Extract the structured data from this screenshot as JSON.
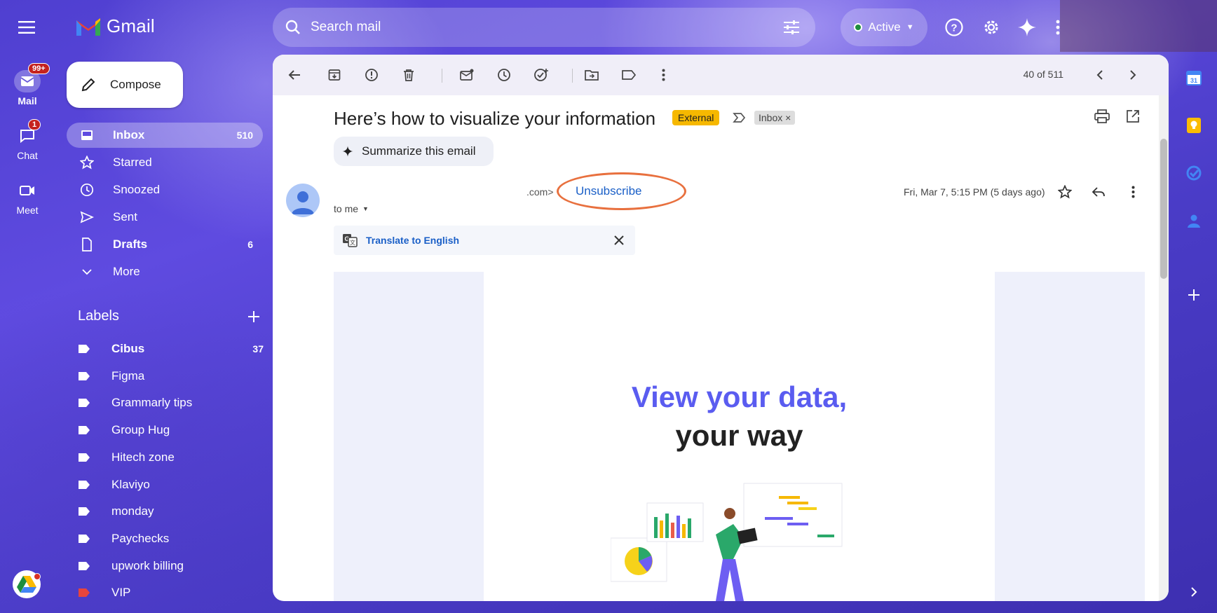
{
  "app": {
    "name": "Gmail"
  },
  "rail": {
    "items": [
      {
        "label": "Mail",
        "badge": "99+"
      },
      {
        "label": "Chat",
        "badge": "1"
      },
      {
        "label": "Meet",
        "badge": ""
      }
    ]
  },
  "search": {
    "placeholder": "Search mail"
  },
  "status": {
    "label": "Active"
  },
  "compose": {
    "label": "Compose"
  },
  "nav": {
    "items": [
      {
        "label": "Inbox",
        "count": "510"
      },
      {
        "label": "Starred",
        "count": ""
      },
      {
        "label": "Snoozed",
        "count": ""
      },
      {
        "label": "Sent",
        "count": ""
      },
      {
        "label": "Drafts",
        "count": "6"
      },
      {
        "label": "More",
        "count": ""
      }
    ]
  },
  "labels": {
    "title": "Labels",
    "items": [
      {
        "label": "Cibus",
        "count": "37",
        "color": "#ffffff"
      },
      {
        "label": "Figma",
        "count": "",
        "color": "#ffffff"
      },
      {
        "label": "Grammarly tips",
        "count": "",
        "color": "#ffffff"
      },
      {
        "label": "Group Hug",
        "count": "",
        "color": "#ffffff"
      },
      {
        "label": "Hitech zone",
        "count": "",
        "color": "#ffffff"
      },
      {
        "label": "Klaviyo",
        "count": "",
        "color": "#ffffff"
      },
      {
        "label": "monday",
        "count": "",
        "color": "#ffffff"
      },
      {
        "label": "Paychecks",
        "count": "",
        "color": "#ffffff"
      },
      {
        "label": "upwork billing",
        "count": "",
        "color": "#ffffff"
      },
      {
        "label": "VIP",
        "count": "",
        "color": "#e8453c"
      }
    ]
  },
  "toolbar": {
    "pager": "40 of 511"
  },
  "email": {
    "subject": "Here’s how to visualize your information",
    "tag_external": "External",
    "tag_inbox": "Inbox",
    "summarize_label": "Summarize this email",
    "sender_tail": ".com>",
    "unsubscribe": "Unsubscribe",
    "to": "to me",
    "date": "Fri, Mar 7, 5:15 PM (5 days ago)",
    "translate": "Translate to English",
    "hero_line1": "View your data,",
    "hero_line2": "your way"
  },
  "colors": {
    "accent": "#5a5cf0",
    "link": "#1a5fc7",
    "highlight_oval": "#e8703e",
    "external_tag": "#f6b800"
  }
}
